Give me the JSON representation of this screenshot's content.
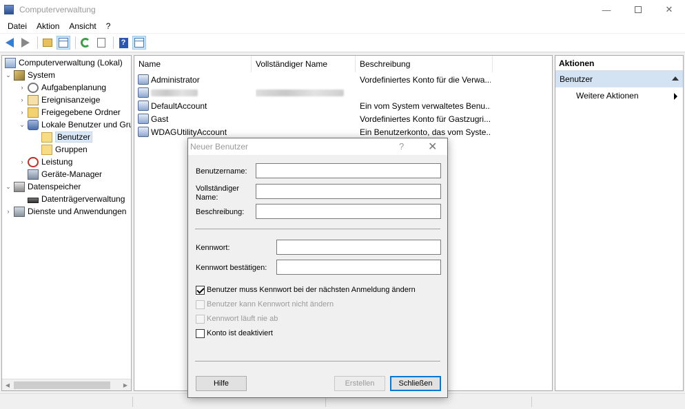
{
  "window": {
    "title": "Computerverwaltung",
    "min": "—",
    "close": "✕"
  },
  "menu": [
    "Datei",
    "Aktion",
    "Ansicht",
    "?"
  ],
  "toolbar": {
    "help_label": "?"
  },
  "tree": {
    "items": [
      {
        "label": "Computerverwaltung (Lokal)",
        "icon": "computer-icon",
        "twisty": ""
      },
      {
        "label": "System",
        "icon": "tools-icon",
        "twisty": "⌄"
      },
      {
        "label": "Aufgabenplanung",
        "icon": "clock-icon",
        "twisty": "›"
      },
      {
        "label": "Ereignisanzeige",
        "icon": "event-viewer-icon",
        "twisty": "›"
      },
      {
        "label": "Freigegebene Ordner",
        "icon": "shared-folder-icon",
        "twisty": "›"
      },
      {
        "label": "Lokale Benutzer und Gruppen",
        "icon": "users-icon",
        "twisty": "⌄"
      },
      {
        "label": "Benutzer",
        "icon": "folder-icon",
        "twisty": ""
      },
      {
        "label": "Gruppen",
        "icon": "folder-icon",
        "twisty": ""
      },
      {
        "label": "Leistung",
        "icon": "performance-icon",
        "twisty": "›"
      },
      {
        "label": "Geräte-Manager",
        "icon": "device-manager-icon",
        "twisty": ""
      },
      {
        "label": "Datenspeicher",
        "icon": "storage-icon",
        "twisty": "⌄"
      },
      {
        "label": "Datenträgerverwaltung",
        "icon": "disk-icon",
        "twisty": ""
      },
      {
        "label": "Dienste und Anwendungen",
        "icon": "services-icon",
        "twisty": "›"
      }
    ],
    "scroll_left": "◀",
    "scroll_right": "▶"
  },
  "list": {
    "columns": [
      "Name",
      "Vollständiger Name",
      "Beschreibung"
    ],
    "rows": [
      {
        "name": "Administrator",
        "fullname": "",
        "desc": "Vordefiniertes Konto für die Verwa..."
      },
      {
        "name": "",
        "fullname": "",
        "desc": ""
      },
      {
        "name": "DefaultAccount",
        "fullname": "",
        "desc": "Ein vom System verwaltetes Benu..."
      },
      {
        "name": "Gast",
        "fullname": "",
        "desc": "Vordefiniertes Konto für Gastzugri..."
      },
      {
        "name": "WDAGUtilityAccount",
        "fullname": "",
        "desc": "Ein Benutzerkonto, das vom Syste..."
      }
    ]
  },
  "actions": {
    "title": "Aktionen",
    "section": "Benutzer",
    "item": "Weitere Aktionen"
  },
  "dialog": {
    "title": "Neuer Benutzer",
    "help": "?",
    "close": "✕",
    "username_label": "Benutzername:",
    "username_value": "",
    "fullname_label_1": "Vollständiger",
    "fullname_label_2": "Name:",
    "fullname_value": "",
    "description_label": "Beschreibung:",
    "description_value": "",
    "password_label": "Kennwort:",
    "password_value": "",
    "confirm_label": "Kennwort bestätigen:",
    "confirm_value": "",
    "checkboxes": [
      {
        "label": "Benutzer muss Kennwort bei der nächsten Anmeldung ändern",
        "checked": true,
        "disabled": false
      },
      {
        "label": "Benutzer kann Kennwort nicht ändern",
        "checked": false,
        "disabled": true
      },
      {
        "label": "Kennwort läuft nie ab",
        "checked": false,
        "disabled": true
      },
      {
        "label": "Konto ist deaktiviert",
        "checked": false,
        "disabled": false
      }
    ],
    "btn_help": "Hilfe",
    "btn_create": "Erstellen",
    "btn_close": "Schließen"
  }
}
